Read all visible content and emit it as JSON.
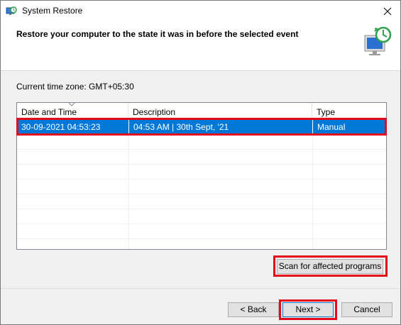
{
  "window": {
    "title": "System Restore",
    "close_glyph": "✕"
  },
  "header": {
    "text": "Restore your computer to the state it was in before the selected event",
    "graphic_icon": "system-restore-monitor-clock-icon"
  },
  "timezone": {
    "label": "Current time zone: GMT+05:30"
  },
  "table": {
    "columns": [
      "Date and Time",
      "Description",
      "Type"
    ],
    "rows": [
      {
        "date": "30-09-2021 04:53:23",
        "description": "04:53 AM | 30th Sept, '21",
        "type": "Manual",
        "selected": true
      }
    ]
  },
  "buttons": {
    "scan": "Scan for affected programs",
    "back": "< Back",
    "next": "Next >",
    "cancel": "Cancel"
  },
  "colors": {
    "selection": "#0078d7",
    "highlight_box": "#e30a1a"
  }
}
